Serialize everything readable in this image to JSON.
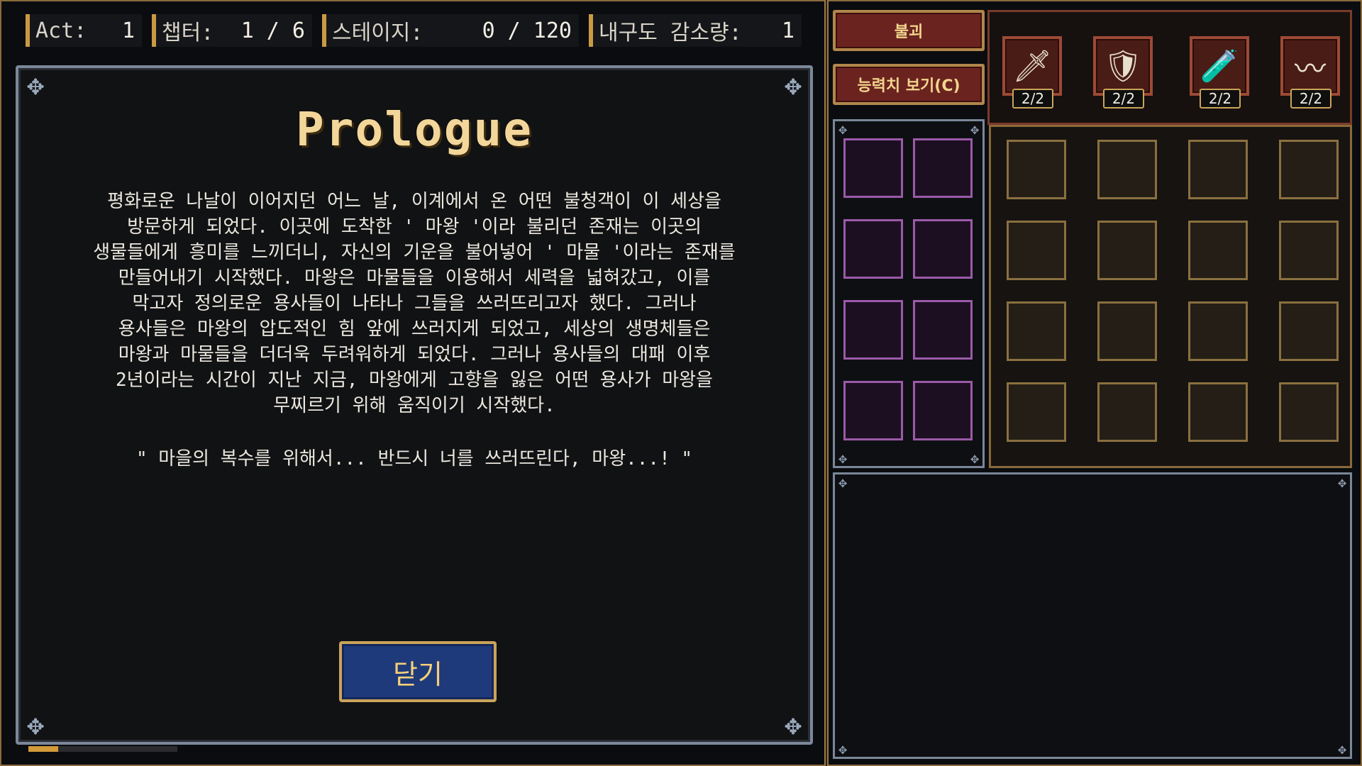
{
  "stats": [
    {
      "label": "Act:",
      "value": "1"
    },
    {
      "label": "챕터:",
      "value": "1 / 6"
    },
    {
      "label": "스테이지:",
      "value": "0 / 120"
    },
    {
      "label": "내구도 감소량:",
      "value": "1"
    }
  ],
  "prologue": {
    "title": "Prologue",
    "story": "평화로운 나날이 이어지던 어느 날, 이계에서 온 어떤 불청객이 이 세상을\n방문하게 되었다. 이곳에 도착한 ' 마왕 '이라 불리던 존재는 이곳의\n생물들에게 흥미를 느끼더니, 자신의 기운을 불어넣어 ' 마물 '이라는 존재를\n만들어내기 시작했다. 마왕은 마물들을 이용해서 세력을 넓혀갔고, 이를\n막고자 정의로운 용사들이 나타나 그들을 쓰러뜨리고자 했다. 그러나\n용사들은 마왕의 압도적인 힘 앞에 쓰러지게 되었고, 세상의 생명체들은\n마왕과 마물들을 더더욱 두려워하게 되었다. 그러나 용사들의 대패 이후\n2년이라는 시간이 지난 지금, 마왕에게 고향을 잃은 어떤 용사가 마왕을\n무찌르기 위해 움직이기 시작했다.",
    "quote": "\" 마을의 복수를 위해서... 반드시 너를 쓰러뜨린다, 마왕...! \"",
    "close_label": "닫기"
  },
  "progress": 0.2,
  "buttons": {
    "surrender": "불괴",
    "view_stats": "능력치 보기(C)"
  },
  "equipment": [
    {
      "icon": "sword-icon",
      "glyph": "🗡",
      "count": "2/2"
    },
    {
      "icon": "armor-icon",
      "glyph": "🛡",
      "count": "2/2"
    },
    {
      "icon": "potion-icon",
      "glyph": "🧪",
      "count": "2/2"
    },
    {
      "icon": "worm-icon",
      "glyph": "〰",
      "count": "2/2"
    }
  ],
  "colors": {
    "accent": "#c99a42",
    "button_red": "#6b2320",
    "button_blue": "#1f3a7a",
    "accessory_slot": "#9a5aa8"
  }
}
